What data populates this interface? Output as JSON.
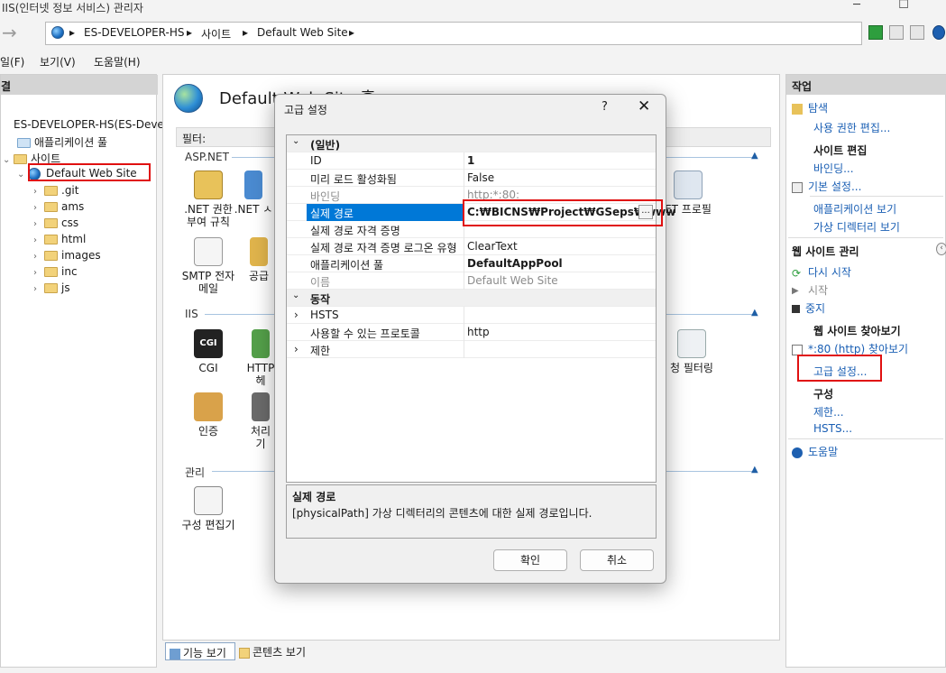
{
  "window": {
    "title": "IIS(인터넷 정보 서비스) 관리자"
  },
  "breadcrumb": [
    "ES-DEVELOPER-HS",
    "사이트",
    "Default Web Site"
  ],
  "menu": [
    "일(F)",
    "보기(V)",
    "도움말(H)"
  ],
  "left_panel": {
    "header": "결",
    "server": "ES-DEVELOPER-HS(ES-Devel",
    "app_pool": "애플리케이션 풀",
    "sites": "사이트",
    "selected_site": "Default Web Site",
    "folders": [
      ".git",
      "ams",
      "css",
      "html",
      "images",
      "inc",
      "js"
    ]
  },
  "center": {
    "title": "Default Web Site 홈",
    "filter_label": "필터:",
    "groups": {
      "aspnet": "ASP.NET",
      "iis": "IIS",
      "management": "관리"
    },
    "features": {
      "net_auth": ".NET 권한\n부여 규칙",
      "net_partial": ".NET ㅅ",
      "smtp": "SMTP 전자\n메일",
      "public": "공급",
      "cgi": "CGI",
      "http": "HTTP\n헤",
      "auth": "인증",
      "handler": "처리기",
      "profile_partial": "ET 프로필",
      "filter_partial": "청 필터링",
      "config_editor": "구성 편집기"
    },
    "tabs": {
      "features": "기능 보기",
      "content": "콘텐츠 보기"
    }
  },
  "right_panel": {
    "header": "작업",
    "explore": "탐색",
    "edit_permissions": "사용 권한 편집...",
    "edit_site": "사이트 편집",
    "bindings": "바인딩...",
    "basic_settings": "기본 설정...",
    "view_apps": "애플리케이션 보기",
    "view_vdirs": "가상 디렉터리 보기",
    "manage_site": "웹 사이트 관리",
    "restart": "다시 시작",
    "start": "시작",
    "stop": "중지",
    "browse_site": "웹 사이트 찾아보기",
    "browse_link": "*:80 (http) 찾아보기",
    "advanced_settings": "고급 설정...",
    "config": "구성",
    "limits": "제한...",
    "hsts": "HSTS...",
    "help": "도움말"
  },
  "dialog": {
    "title": "고급 설정",
    "help": "?",
    "close": "✕",
    "cat_general": "(일반)",
    "cat_behavior": "동작",
    "rows": {
      "id_key": "ID",
      "id_val": "1",
      "preload_key": "미리 로드 활성화됨",
      "preload_val": "False",
      "binding_key": "바인딩",
      "binding_val": "http:*:80:",
      "path_key": "실제 경로",
      "path_val": "C:₩BICNS₩Project₩GSeps₩www",
      "cred_key": "실제 경로 자격 증명",
      "logon_key": "실제 경로 자격 증명 로그온 유형",
      "logon_val": "ClearText",
      "pool_key": "애플리케이션 풀",
      "pool_val": "DefaultAppPool",
      "name_key": "이름",
      "name_val": "Default Web Site",
      "hsts_key": "HSTS",
      "proto_key": "사용할 수 있는 프로토콜",
      "proto_val": "http",
      "limits_key": "제한"
    },
    "browse_btn": "...",
    "desc_title": "실제 경로",
    "desc_text": "[physicalPath] 가상 디렉터리의 콘텐츠에 대한 실제 경로입니다.",
    "ok": "확인",
    "cancel": "취소"
  },
  "colors": {
    "highlight": "#0078d7",
    "link": "#1a5fb4",
    "annotation": "#e01010"
  }
}
